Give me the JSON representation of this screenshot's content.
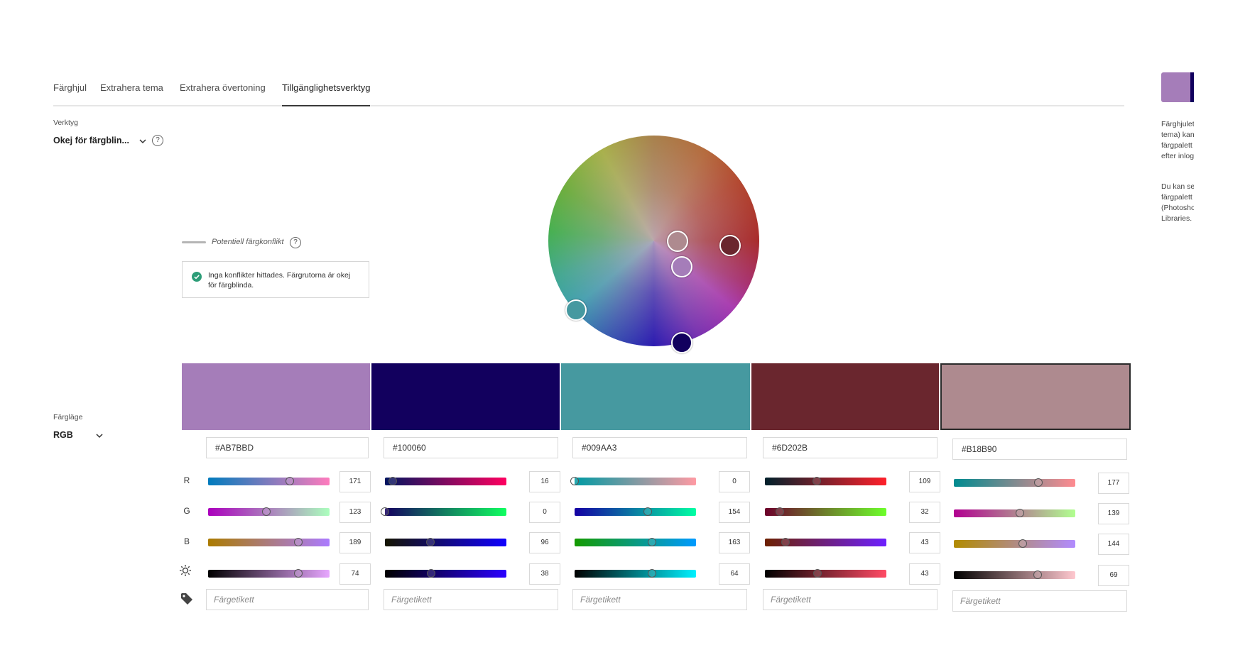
{
  "tabs": [
    "Färghjul",
    "Extrahera tema",
    "Extrahera övertoning",
    "Tillgänglighetsverktyg"
  ],
  "active_tab": 3,
  "tool": {
    "label": "Verktyg",
    "value": "Okej för färgblin...",
    "help": "?"
  },
  "conflict": {
    "legend": "Potentiell färgkonflikt",
    "help": "?",
    "status": "Inga konflikter hittades. Färgrutorna är okej för färgblinda."
  },
  "color_mode": {
    "label": "Färgläge",
    "value": "RGB"
  },
  "row_labels": {
    "r": "R",
    "g": "G",
    "b": "B"
  },
  "icons": {
    "brightness": "sun-icon",
    "tag": "tag-icon",
    "help": "help-circle-icon",
    "check": "check-circle-icon",
    "chevron": "chevron-down-icon"
  },
  "swatches": [
    {
      "hex": "#AB7BBD",
      "color": "#A57DB9",
      "r": 171,
      "g": 123,
      "b": 189,
      "brightness": 74,
      "tag_placeholder": "Färgetikett",
      "selected": false
    },
    {
      "hex": "#100060",
      "color": "#12005E",
      "r": 16,
      "g": 0,
      "b": 96,
      "brightness": 38,
      "tag_placeholder": "Färgetikett",
      "selected": false
    },
    {
      "hex": "#009AA3",
      "color": "#4699A0",
      "r": 0,
      "g": 154,
      "b": 163,
      "brightness": 64,
      "tag_placeholder": "Färgetikett",
      "selected": false
    },
    {
      "hex": "#6D202B",
      "color": "#6A262E",
      "r": 109,
      "g": 32,
      "b": 43,
      "brightness": 43,
      "tag_placeholder": "Färgetikett",
      "selected": false
    },
    {
      "hex": "#B18B90",
      "color": "#AE8A8F",
      "r": 177,
      "g": 139,
      "b": 144,
      "brightness": 69,
      "tag_placeholder": "Färgetikett",
      "selected": true
    }
  ],
  "right_panel": {
    "lines_1": [
      "Färghjulet",
      "tema) kan",
      "färgpalett",
      "efter inlog"
    ],
    "lines_2": [
      "Du kan se",
      "färgpalett",
      "(Photosho",
      "Libraries."
    ]
  }
}
